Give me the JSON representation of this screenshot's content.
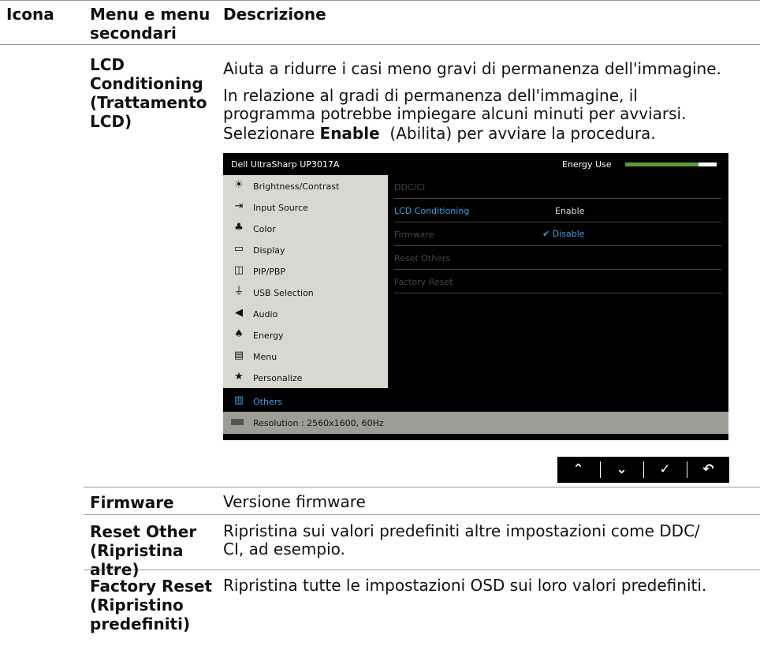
{
  "table": {
    "headers": {
      "icon": "Icona",
      "menu_line1": "Menu e menu",
      "menu_line2": "secondari",
      "desc": "Descrizione"
    }
  },
  "lcd": {
    "name_lines": [
      "LCD",
      "Conditioning",
      "(Trattamento",
      "LCD)"
    ],
    "desc1": "Aiuta a ridurre i casi meno gravi di permanenza dell'immagine.",
    "desc2_lines": [
      "In relazione al gradi di permanenza dell'immagine, il",
      "programma potrebbe impiegare alcuni minuti per avviarsi."
    ],
    "desc3_pre": "Selezionare ",
    "desc3_bold": "Enable",
    "desc3_post": "  (Abilita) per avviare la procedura."
  },
  "osd": {
    "title": "Dell UltraSharp UP3017A",
    "energy_label": "Energy Use",
    "energy_level_percent": 80,
    "colors": {
      "selected": "#3aa0e6",
      "energy": "#5a9a3a",
      "panel": "#d8d8d0"
    },
    "menu": [
      {
        "icon": "brightness-icon",
        "glyph": "☀",
        "label": "Brightness/Contrast"
      },
      {
        "icon": "input-source-icon",
        "glyph": "⇥",
        "label": "Input Source"
      },
      {
        "icon": "color-icon",
        "glyph": "♣",
        "label": "Color"
      },
      {
        "icon": "display-icon",
        "glyph": "▭",
        "label": "Display"
      },
      {
        "icon": "pip-pbp-icon",
        "glyph": "◫",
        "label": "PIP/PBP"
      },
      {
        "icon": "usb-selection-icon",
        "glyph": "⏚",
        "label": "USB Selection"
      },
      {
        "icon": "audio-icon",
        "glyph": "◀",
        "label": "Audio"
      },
      {
        "icon": "energy-icon",
        "glyph": "♠",
        "label": "Energy"
      },
      {
        "icon": "menu-icon",
        "glyph": "▤",
        "label": "Menu"
      },
      {
        "icon": "star-icon",
        "glyph": "★",
        "label": "Personalize"
      }
    ],
    "selected": {
      "icon": "others-icon",
      "glyph": "▥",
      "label": "Others"
    },
    "options": [
      {
        "label": "DDC/CI",
        "value": ""
      },
      {
        "label": "LCD Conditioning",
        "value": "Enable"
      },
      {
        "label": "Firmware",
        "value": "Disable"
      },
      {
        "label": "Reset Others",
        "value": ""
      },
      {
        "label": "Factory Reset",
        "value": ""
      }
    ],
    "footer": "Resolution : 2560x1600, 60Hz",
    "nav": [
      "⌃",
      "⌄",
      "✓",
      "↶"
    ]
  },
  "rows": [
    {
      "name_lines": [
        "Firmware"
      ],
      "desc_lines": [
        "Versione firmware"
      ]
    },
    {
      "name_lines": [
        "Reset Other",
        "(Ripristina",
        "altre)"
      ],
      "desc_lines": [
        "Ripristina sui valori predefiniti altre impostazioni come DDC/",
        "CI, ad esempio."
      ]
    },
    {
      "name_lines": [
        "Factory Reset",
        "(Ripristino",
        "predefiniti)"
      ],
      "desc_lines": [
        "Ripristina tutte le impostazioni OSD sui loro valori predefiniti."
      ]
    }
  ]
}
